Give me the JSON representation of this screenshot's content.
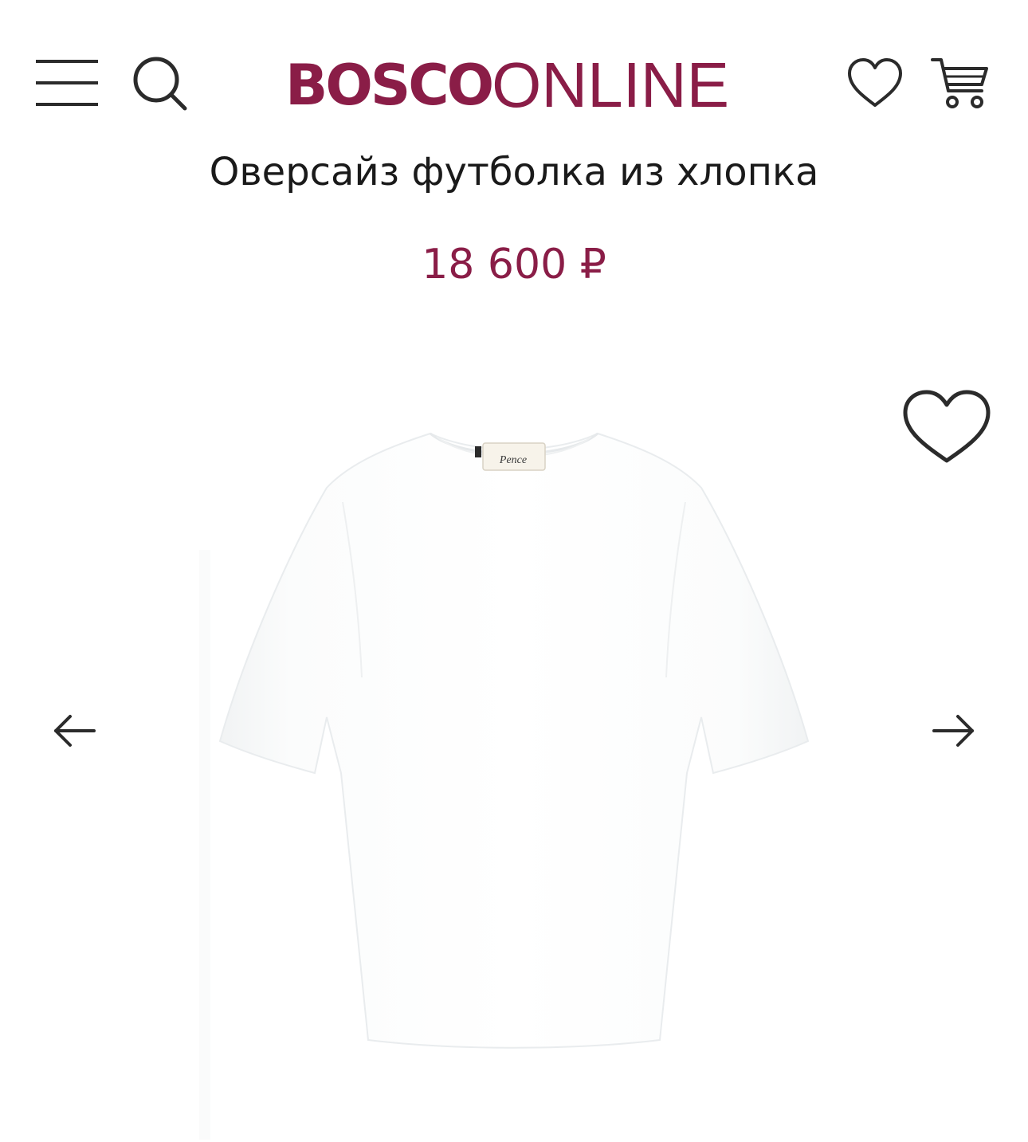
{
  "header": {
    "logo_bold": "BOSCO",
    "logo_light": "ONLINE",
    "icons": {
      "menu": "hamburger-menu-icon",
      "search": "search-icon",
      "favorites": "heart-icon",
      "cart": "cart-icon"
    }
  },
  "product": {
    "title": "Оверсайз футболка из хлопка",
    "price": "18 600 ₽",
    "image_label": "Pence"
  },
  "gallery": {
    "icons": {
      "favorite": "heart-icon",
      "prev": "arrow-left-icon",
      "next": "arrow-right-icon"
    }
  },
  "colors": {
    "brand": "#8a1d47",
    "icon_stroke": "#2b2b2b",
    "text": "#1a1a1a",
    "background": "#ffffff"
  }
}
